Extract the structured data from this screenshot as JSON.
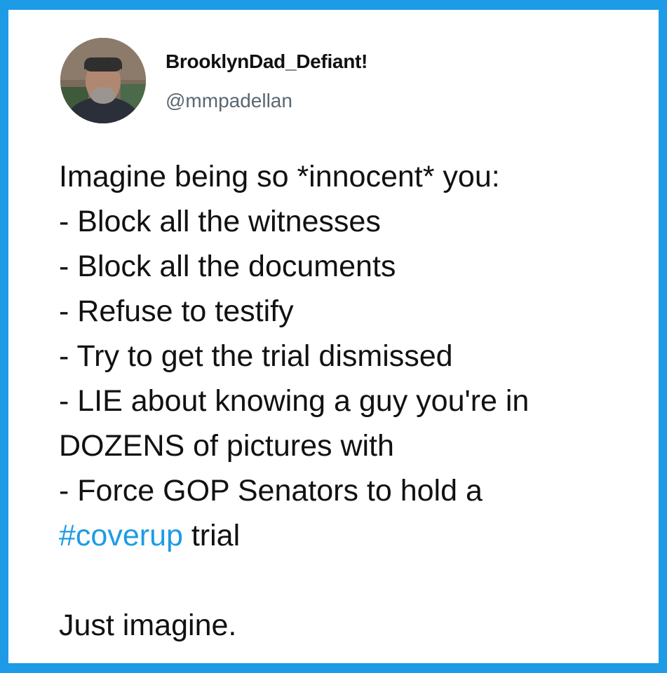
{
  "author": {
    "display_name": "BrooklynDad_Defiant!",
    "handle": "@mmpadellan"
  },
  "tweet": {
    "lines": [
      "Imagine being so *innocent* you:",
      "- Block all the witnesses",
      "- Block all the documents",
      "- Refuse to testify",
      "- Try to get the trial dismissed",
      "- LIE about knowing a guy you're in",
      "DOZENS of pictures with",
      "- Force GOP Senators to hold a"
    ],
    "hashtag": "#coverup",
    "hashtag_suffix": " trial",
    "closing": "Just imagine."
  },
  "colors": {
    "frame": "#1d9be6",
    "hashtag": "#1d9be6",
    "text": "#111111",
    "handle": "#5b6770"
  },
  "icons": {
    "avatar": "profile-photo"
  }
}
